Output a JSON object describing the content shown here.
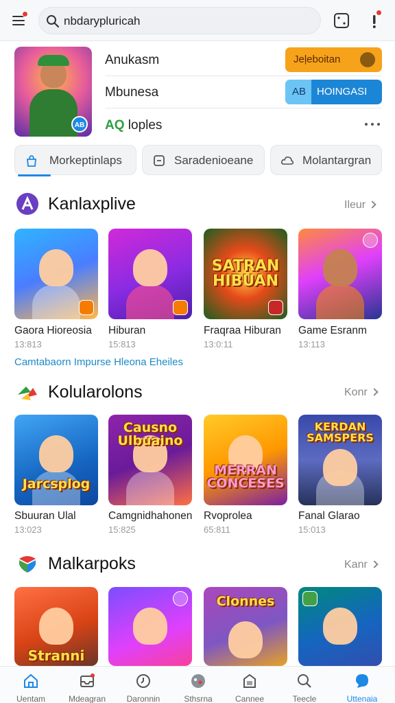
{
  "topbar": {
    "search_value": "nbdarypluricah",
    "menu_icon": "hamburger-menu-icon",
    "right_icons": [
      "dice-icon",
      "notification-icon"
    ]
  },
  "profile": {
    "name": "Anukasm",
    "subtitle": "Mbunesa",
    "stat_prefix": "AQ",
    "stat_label": "loples",
    "avatar_badge": "AB",
    "button_primary": "Jeļeboitan",
    "button_secondary_left": "AB",
    "button_secondary_right": "HOINGASI"
  },
  "chips": [
    {
      "label": "Morkeptinlaps",
      "icon": "bag-icon",
      "active": true
    },
    {
      "label": "Saradenioeane",
      "icon": "box-icon",
      "active": false
    },
    {
      "label": "Molantargran",
      "icon": "cloud-icon",
      "active": false
    }
  ],
  "sections": [
    {
      "title": "Kanlaxplive",
      "more": "Ileur",
      "icon": "a-logo-icon",
      "cards": [
        {
          "title": "Gaora Hioreosia",
          "time": "13:813",
          "overlay": "",
          "badge": "B"
        },
        {
          "title": "Hiburan",
          "time": "15:813",
          "overlay": "",
          "badge": "B"
        },
        {
          "title": "Fraqraa Hiburan",
          "time": "13:0:11",
          "overlay": "SATRAN HIBUAN",
          "badge": "R"
        },
        {
          "title": "Game Esranm",
          "time": "13:113",
          "overlay": "",
          "badge": ""
        }
      ],
      "link": "Camtabaorn Impurse Hleona Eheiles"
    },
    {
      "title": "Kolularolons",
      "more": "Konr",
      "icon": "colorful-bird-icon",
      "cards": [
        {
          "title": "Sbuuran Ulal",
          "time": "13:023",
          "overlay": "Jarcsplog",
          "badge": ""
        },
        {
          "title": "Camgnidhahonen",
          "time": "15:825",
          "overlay": "Causno Ulbuaino",
          "badge": ""
        },
        {
          "title": "Rvoprolea",
          "time": "65:811",
          "overlay": "MERRAN CONCESES",
          "badge": ""
        },
        {
          "title": "Fanal Glarao",
          "time": "15:013",
          "overlay": "KERDAN SAMSPERS",
          "badge": ""
        }
      ]
    },
    {
      "title": "Malkarpoks",
      "more": "Kanr",
      "icon": "colorful-shield-icon",
      "cards": [
        {
          "title": "",
          "time": "",
          "overlay": "Stranni",
          "badge": ""
        },
        {
          "title": "",
          "time": "",
          "overlay": "",
          "badge": ""
        },
        {
          "title": "",
          "time": "",
          "overlay": "Clonnes",
          "badge": ""
        },
        {
          "title": "",
          "time": "",
          "overlay": "",
          "badge": ""
        }
      ]
    }
  ],
  "bottom_nav": [
    {
      "label": "Uentam",
      "icon": "home-icon",
      "active": false
    },
    {
      "label": "Mdeagran",
      "icon": "inbox-icon",
      "active": false
    },
    {
      "label": "Daronnin",
      "icon": "clock-icon",
      "active": false
    },
    {
      "label": "Sthsrna",
      "icon": "game-globe-icon",
      "active": false
    },
    {
      "label": "Cannee",
      "icon": "store-icon",
      "active": false
    },
    {
      "label": "Teecle",
      "icon": "search-icon",
      "active": false
    },
    {
      "label": "Uttenaia",
      "icon": "profile-bubble-icon",
      "active": true
    }
  ],
  "colors": {
    "accent": "#1e88e5",
    "orange": "#f7a21b",
    "link": "#1b8ac9",
    "badge_red": "#e53935"
  }
}
